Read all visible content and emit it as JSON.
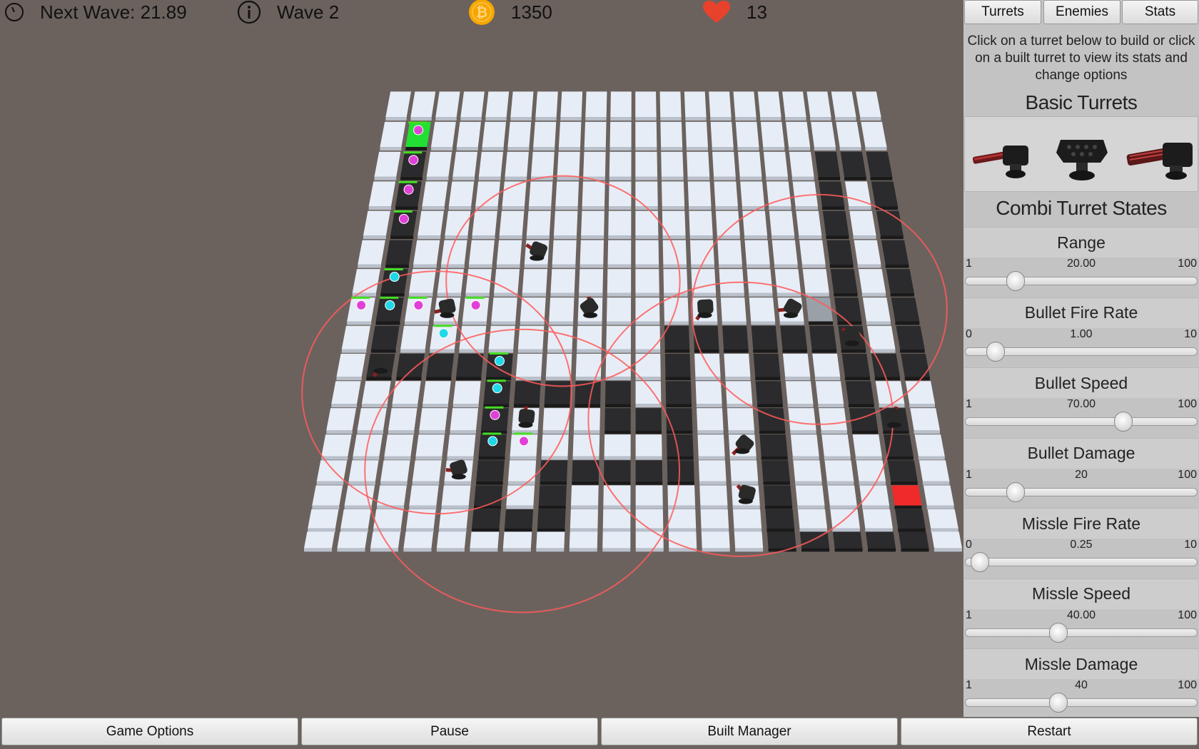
{
  "hud": {
    "next_wave_label": "Next Wave: 21.89",
    "wave_label": "Wave 2",
    "coins": "1350",
    "lives": "13"
  },
  "panel": {
    "tabs": [
      "Turrets",
      "Enemies",
      "Stats"
    ],
    "instructions": "Click on a turret below to build or click on a built turret to view its stats and change options",
    "basic_turrets_title": "Basic Turrets",
    "basic_turrets": [
      {
        "icon": "minigun-turret-icon"
      },
      {
        "icon": "missile-pod-turret-icon"
      },
      {
        "icon": "gatling-turret-icon"
      }
    ],
    "combi_title": "Combi Turret States",
    "stats": [
      {
        "name": "Range",
        "min": "1",
        "value": "20.00",
        "max": "100",
        "level": 0.192
      },
      {
        "name": "Bullet Fire Rate",
        "min": "0",
        "value": "1.00",
        "max": "10",
        "level": 0.1
      },
      {
        "name": "Bullet Speed",
        "min": "1",
        "value": "70.00",
        "max": "100",
        "level": 0.697
      },
      {
        "name": "Bullet Damage",
        "min": "1",
        "value": "20",
        "max": "100",
        "level": 0.192
      },
      {
        "name": "Missle Fire Rate",
        "min": "0",
        "value": "0.25",
        "max": "10",
        "level": 0.025
      },
      {
        "name": "Missle Speed",
        "min": "1",
        "value": "40.00",
        "max": "100",
        "level": 0.394
      },
      {
        "name": "Missle Damage",
        "min": "1",
        "value": "40",
        "max": "100",
        "level": 0.394
      }
    ]
  },
  "bottom_bar": {
    "buttons": [
      "Game Options",
      "Pause",
      "Built Manager",
      "Restart"
    ]
  },
  "colors": {
    "background": "#6b625e",
    "tile": "#e7edf6",
    "path_tile": "#2b2b2d",
    "start_tile": "#22e033",
    "end_tile": "#f02a2a",
    "range_ring": "#ff5a5a",
    "enemy_magenta": "#e040d8",
    "enemy_cyan": "#20d8e8",
    "health_bar": "#44dd22",
    "coin": "#f7a600",
    "heart": "#e8412c"
  },
  "board": {
    "rows": 17,
    "cols": 20,
    "path_cells": [
      [
        1,
        1
      ],
      [
        2,
        1
      ],
      [
        3,
        1
      ],
      [
        4,
        1
      ],
      [
        5,
        1
      ],
      [
        6,
        1
      ],
      [
        7,
        1
      ],
      [
        8,
        1
      ],
      [
        9,
        1
      ],
      [
        9,
        2
      ],
      [
        9,
        3
      ],
      [
        9,
        4
      ],
      [
        9,
        5
      ],
      [
        10,
        5
      ],
      [
        11,
        5
      ],
      [
        12,
        5
      ],
      [
        13,
        5
      ],
      [
        14,
        5
      ],
      [
        15,
        5
      ],
      [
        15,
        6
      ],
      [
        15,
        7
      ],
      [
        14,
        7
      ],
      [
        13,
        7
      ],
      [
        13,
        8
      ],
      [
        13,
        9
      ],
      [
        13,
        10
      ],
      [
        13,
        11
      ],
      [
        12,
        11
      ],
      [
        11,
        11
      ],
      [
        10,
        11
      ],
      [
        9,
        11
      ],
      [
        8,
        11
      ],
      [
        8,
        12
      ],
      [
        8,
        13
      ],
      [
        8,
        14
      ],
      [
        9,
        14
      ],
      [
        10,
        14
      ],
      [
        11,
        14
      ],
      [
        12,
        14
      ],
      [
        13,
        14
      ],
      [
        14,
        14
      ],
      [
        15,
        14
      ],
      [
        16,
        14
      ],
      [
        16,
        15
      ],
      [
        16,
        16
      ],
      [
        16,
        17
      ],
      [
        16,
        18
      ],
      [
        15,
        18
      ],
      [
        14,
        18
      ],
      [
        13,
        18
      ],
      [
        12,
        18
      ],
      [
        11,
        18
      ],
      [
        11,
        17
      ],
      [
        10,
        17
      ],
      [
        9,
        17
      ],
      [
        9,
        18
      ],
      [
        9,
        19
      ],
      [
        8,
        19
      ],
      [
        7,
        19
      ],
      [
        6,
        19
      ],
      [
        5,
        19
      ],
      [
        4,
        19
      ],
      [
        3,
        19
      ],
      [
        2,
        19
      ],
      [
        2,
        18
      ],
      [
        2,
        17
      ],
      [
        3,
        17
      ],
      [
        4,
        17
      ],
      [
        5,
        17
      ],
      [
        6,
        17
      ],
      [
        7,
        17
      ],
      [
        8,
        17
      ],
      [
        8,
        16
      ],
      [
        8,
        15
      ],
      [
        10,
        6
      ],
      [
        10,
        7
      ],
      [
        10,
        8
      ],
      [
        10,
        9
      ],
      [
        11,
        9
      ],
      [
        11,
        10
      ]
    ],
    "start_cell": [
      1,
      1
    ],
    "end_cell": [
      14,
      18
    ],
    "grey_cell": [
      7,
      16
    ],
    "turrets": [
      [
        9,
        1
      ],
      [
        7,
        3
      ],
      [
        5,
        6
      ],
      [
        7,
        8
      ],
      [
        7,
        12
      ],
      [
        7,
        15
      ],
      [
        8,
        17
      ],
      [
        11,
        6
      ],
      [
        12,
        13
      ],
      [
        13,
        4
      ],
      [
        14,
        13
      ],
      [
        11,
        18
      ]
    ],
    "enemies": [
      {
        "cell": [
          1,
          1
        ],
        "color": "magenta"
      },
      {
        "cell": [
          2,
          1
        ],
        "color": "magenta"
      },
      {
        "cell": [
          3,
          1
        ],
        "color": "magenta"
      },
      {
        "cell": [
          4,
          1
        ],
        "color": "magenta"
      },
      {
        "cell": [
          6,
          1
        ],
        "color": "cyan"
      },
      {
        "cell": [
          7,
          1
        ],
        "color": "cyan"
      },
      {
        "cell": [
          7,
          0
        ],
        "color": "magenta"
      },
      {
        "cell": [
          7,
          2
        ],
        "color": "magenta"
      },
      {
        "cell": [
          8,
          3
        ],
        "color": "cyan"
      },
      {
        "cell": [
          7,
          4
        ],
        "color": "magenta"
      },
      {
        "cell": [
          9,
          5
        ],
        "color": "cyan"
      },
      {
        "cell": [
          10,
          5
        ],
        "color": "cyan"
      },
      {
        "cell": [
          11,
          5
        ],
        "color": "magenta"
      },
      {
        "cell": [
          12,
          6
        ],
        "color": "magenta"
      },
      {
        "cell": [
          12,
          5
        ],
        "color": "cyan"
      }
    ],
    "range_rings": [
      {
        "cell": [
          10,
          3
        ],
        "radius_cells": 4.5
      },
      {
        "cell": [
          13,
          6
        ],
        "radius_cells": 5
      },
      {
        "cell": [
          6,
          7
        ],
        "radius_cells": 4.2
      },
      {
        "cell": [
          11,
          13
        ],
        "radius_cells": 5
      },
      {
        "cell": [
          7,
          16
        ],
        "radius_cells": 4.5
      }
    ]
  }
}
